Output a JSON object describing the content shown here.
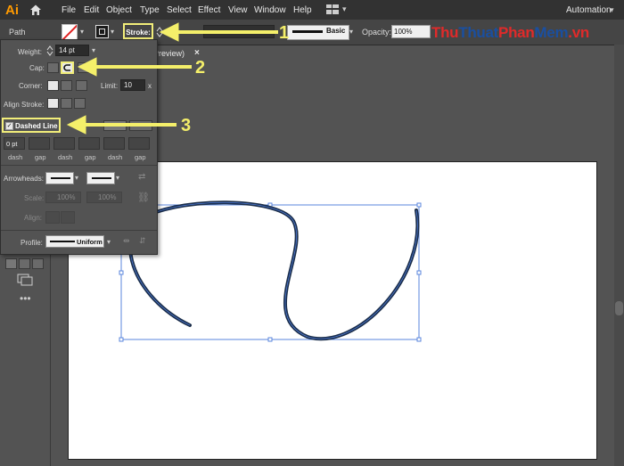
{
  "menubar": {
    "logo": "Ai",
    "items": [
      "File",
      "Edit",
      "Object",
      "Type",
      "Select",
      "Effect",
      "View",
      "Window",
      "Help"
    ],
    "workspace": "Automation"
  },
  "controlbar": {
    "selection_label": "Path",
    "stroke_label": "Stroke:",
    "brush_label": "Basic",
    "opacity_label": "Opacity:",
    "opacity_value": "100%"
  },
  "watermark": {
    "parts": [
      "Thu",
      "Thuat",
      "Phan",
      "Mem",
      ".vn"
    ],
    "colors": [
      "#e02a2a",
      "#1a4fa0",
      "#e02a2a",
      "#1a4fa0",
      "#e02a2a"
    ]
  },
  "tab": {
    "label": "Preview)",
    "close": "×"
  },
  "stroke_panel": {
    "weight_label": "Weight:",
    "weight_value": "14 pt",
    "cap_label": "Cap:",
    "corner_label": "Corner:",
    "limit_label": "Limit:",
    "limit_value": "10",
    "limit_unit": "x",
    "align_label": "Align Stroke:",
    "dashed_label": "Dashed Line",
    "dashed_checked": true,
    "dash_first_value": "0 pt",
    "dash_labels": [
      "dash",
      "gap",
      "dash",
      "gap",
      "dash",
      "gap"
    ],
    "arrowheads_label": "Arrowheads:",
    "scale_label": "Scale:",
    "scale_value_1": "100%",
    "scale_value_2": "100%",
    "align_arrows_label": "Align:",
    "profile_label": "Profile:",
    "profile_value": "Uniform"
  },
  "annotations": [
    "1",
    "2",
    "3"
  ],
  "colors": {
    "annotation": "#f4ef6a",
    "path_stroke": "#1b2e4a",
    "selection": "#4f7bd8"
  }
}
